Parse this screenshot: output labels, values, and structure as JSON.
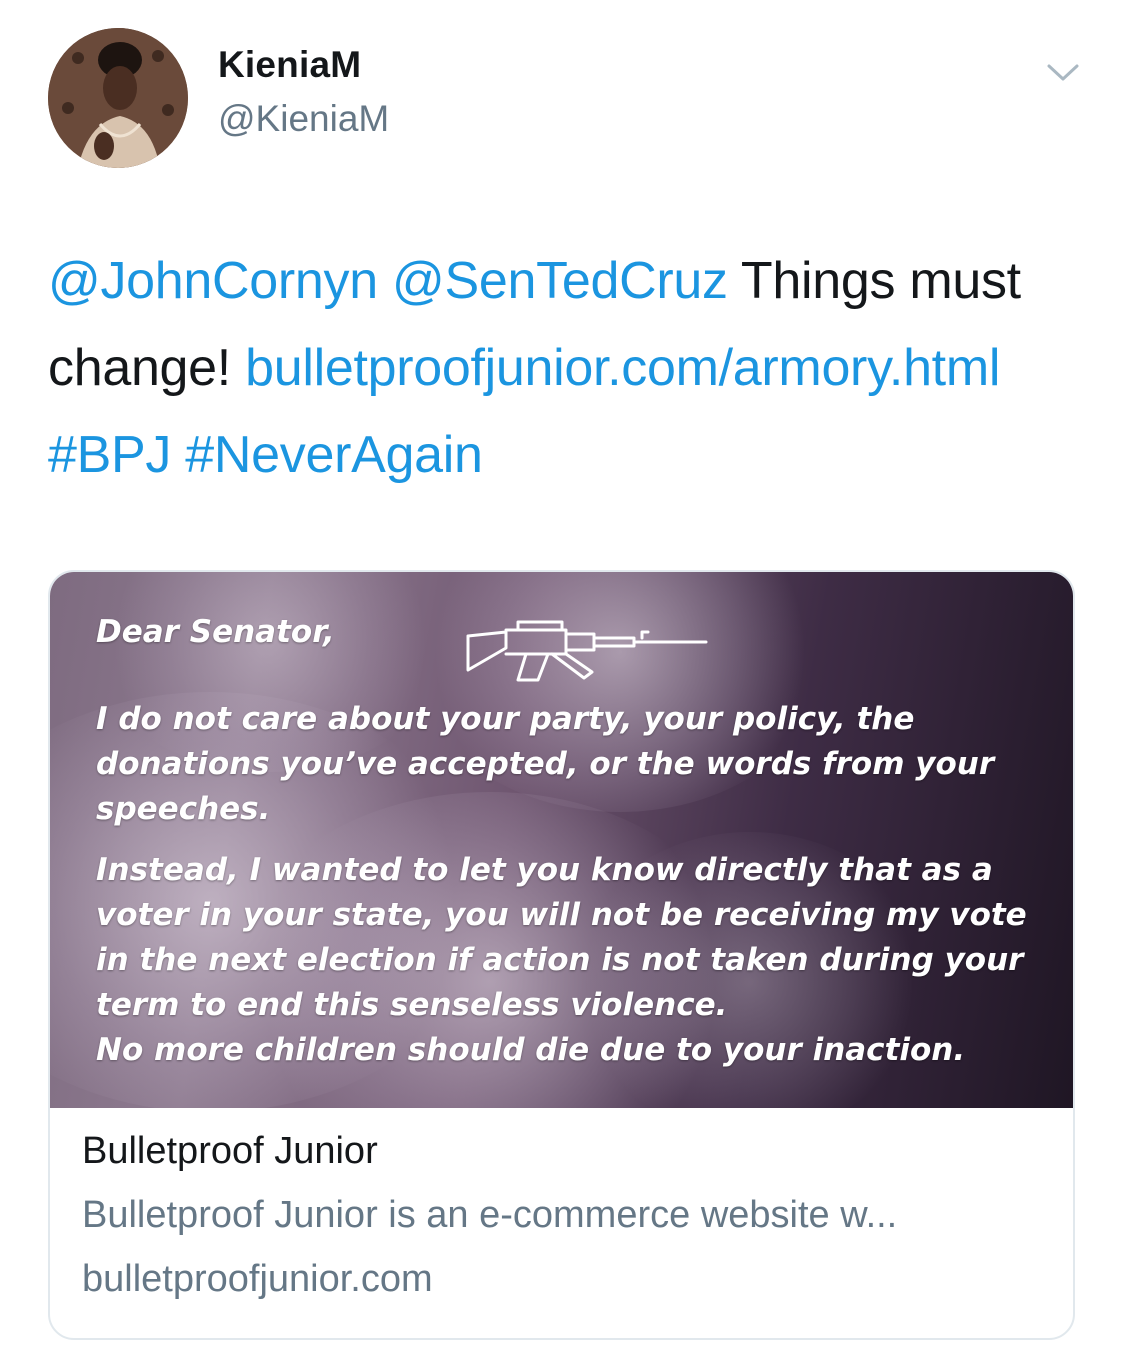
{
  "author": {
    "display_name": "KieniaM",
    "handle": "@KieniaM"
  },
  "tweet": {
    "mention1": "@JohnCornyn",
    "mention2": "@SenTedCruz",
    "text1": " Things must change! ",
    "link": "bulletproofjunior.com/armory.html",
    "hashtag1": "#BPJ",
    "hashtag2": "#NeverAgain"
  },
  "card": {
    "image_text": {
      "salutation": "Dear Senator,",
      "paragraph1": "I do not care about your party, your policy, the donations you’ve accepted, or the words from your speeches.",
      "paragraph2": "Instead, I wanted to let you know directly that as a voter in your state, you will not be receiving my vote in the next election if action is not taken during your term to end this senseless violence.",
      "paragraph3": "No more children should die due to your inaction."
    },
    "title": "Bulletproof Junior",
    "description": "Bulletproof Junior is an e-commerce website w...",
    "domain": "bulletproofjunior.com"
  },
  "icons": {
    "menu_caret": "chevron-down-icon",
    "rifle": "rifle-icon"
  },
  "colors": {
    "link": "#1b95e0",
    "secondary_text": "#657786",
    "primary_text": "#14171a",
    "border": "#e1e8ed"
  }
}
